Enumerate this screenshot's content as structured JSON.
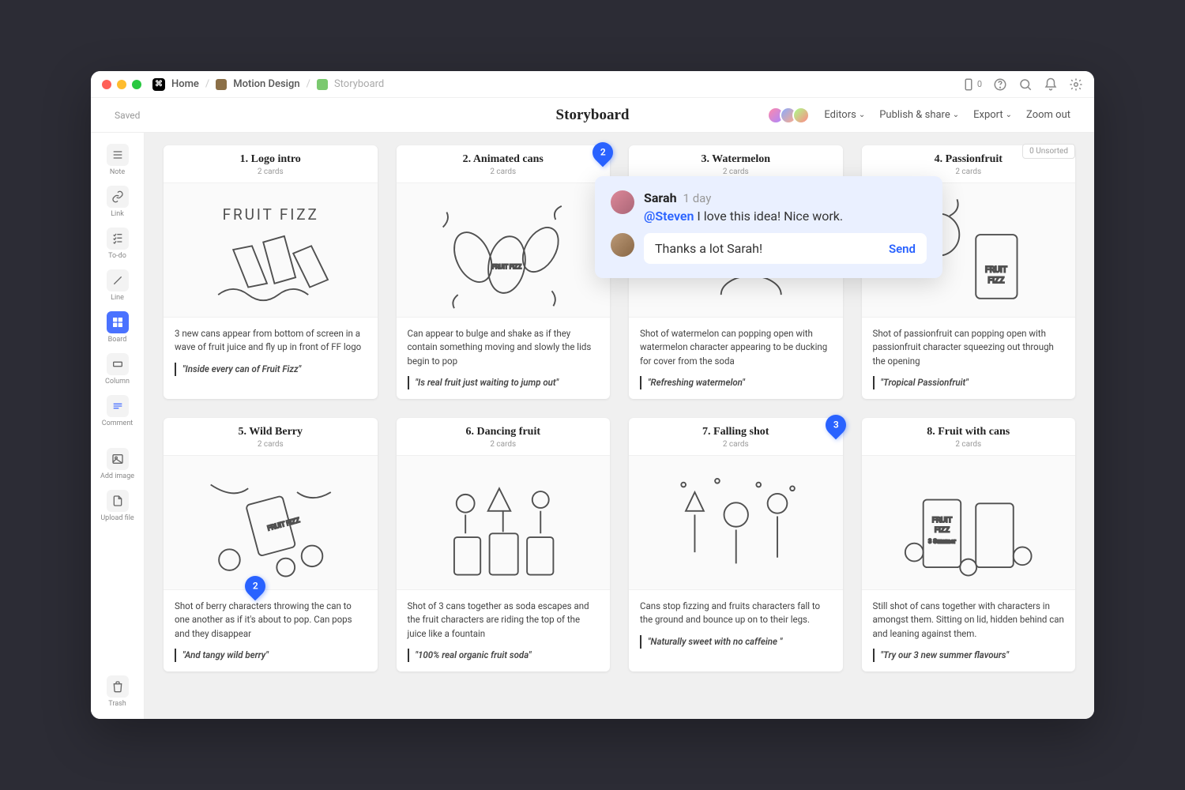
{
  "breadcrumbs": {
    "home": "Home",
    "level1": "Motion Design",
    "level2": "Storyboard"
  },
  "titlebar": {
    "notif_count": "0"
  },
  "doc": {
    "saved": "Saved",
    "title": "Storyboard"
  },
  "actions": {
    "editors": "Editors",
    "publish": "Publish & share",
    "export": "Export",
    "zoom": "Zoom out"
  },
  "sidebar": {
    "note": "Note",
    "link": "Link",
    "todo": "To-do",
    "line": "Line",
    "board": "Board",
    "column": "Column",
    "comment": "Comment",
    "add_image": "Add image",
    "upload_file": "Upload file",
    "trash": "Trash"
  },
  "unsorted": {
    "count": "0",
    "label": "Unsorted"
  },
  "cards": [
    {
      "title": "1. Logo intro",
      "sub": "2 cards",
      "desc": "3 new cans appear from bottom of screen  in a wave of fruit juice and fly up in front of FF logo",
      "quote": "\"Inside every can of Fruit Fizz\""
    },
    {
      "title": "2. Animated cans",
      "sub": "2 cards",
      "desc": "Can appear to bulge and shake as if they contain something moving and slowly the lids begin to pop",
      "quote": "\"Is real fruit just waiting to jump out\"",
      "pin": "2",
      "pin_pos": "tr"
    },
    {
      "title": "3. Watermelon",
      "sub": "2 cards",
      "desc": "Shot of watermelon can popping open with watermelon character appearing to be ducking for cover from the soda",
      "quote": "\"Refreshing watermelon\""
    },
    {
      "title": "4. Passionfruit",
      "sub": "2 cards",
      "desc": "Shot of passionfruit can popping open with passionfruit character squeezing out through the opening",
      "quote": "\"Tropical Passionfruit\""
    },
    {
      "title": "5. Wild Berry",
      "sub": "2 cards",
      "desc": "Shot of berry characters throwing the can to one another as if it's about to pop. Can pops and they disappear",
      "quote": "\"And tangy wild berry\"",
      "pin": "2",
      "pin_pos": "img-bl"
    },
    {
      "title": "6. Dancing fruit",
      "sub": "2 cards",
      "desc": "Shot of 3 cans together as soda escapes and the fruit characters are riding the top of the juice like a fountain",
      "quote": "\"100% real organic fruit soda\""
    },
    {
      "title": "7. Falling shot",
      "sub": "2 cards",
      "desc": "Cans stop fizzing and fruits characters fall to the ground and bounce up on to their legs.",
      "quote": "\"Naturally sweet with no caffeine \"",
      "pin": "3",
      "pin_pos": "tr"
    },
    {
      "title": "8. Fruit with cans",
      "sub": "2 cards",
      "desc": "Still shot of cans together with characters in amongst them. Sitting on lid, hidden behind can and leaning against them.",
      "quote": "\"Try our 3 new summer flavours\""
    }
  ],
  "comment_popup": {
    "author": "Sarah",
    "time": "1 day",
    "mention": "@Steven",
    "text": " I love this idea! Nice work.",
    "reply": "Thanks a lot Sarah!",
    "send": "Send"
  }
}
